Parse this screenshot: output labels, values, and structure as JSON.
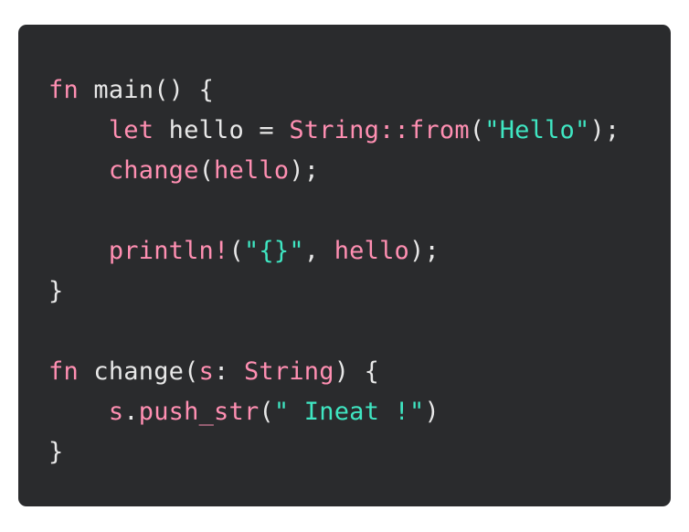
{
  "colors": {
    "background": "#2a2b2d",
    "plain": "#e8e8e8",
    "keyword": "#ff8fb2",
    "string": "#3fe6c2"
  },
  "code": {
    "lines": [
      [
        {
          "text": "fn",
          "kind": "kw"
        },
        {
          "text": " main() {",
          "kind": "plain"
        }
      ],
      [
        {
          "text": "    ",
          "kind": "plain"
        },
        {
          "text": "let",
          "kind": "kw"
        },
        {
          "text": " hello = ",
          "kind": "plain"
        },
        {
          "text": "String::from",
          "kind": "type"
        },
        {
          "text": "(",
          "kind": "plain"
        },
        {
          "text": "\"Hello\"",
          "kind": "str"
        },
        {
          "text": ");",
          "kind": "plain"
        }
      ],
      [
        {
          "text": "    ",
          "kind": "plain"
        },
        {
          "text": "change",
          "kind": "fn"
        },
        {
          "text": "(",
          "kind": "plain"
        },
        {
          "text": "hello",
          "kind": "fn"
        },
        {
          "text": ");",
          "kind": "plain"
        }
      ],
      [
        {
          "text": "",
          "kind": "plain"
        }
      ],
      [
        {
          "text": "    ",
          "kind": "plain"
        },
        {
          "text": "println!",
          "kind": "fn"
        },
        {
          "text": "(",
          "kind": "plain"
        },
        {
          "text": "\"{}\"",
          "kind": "str"
        },
        {
          "text": ", ",
          "kind": "plain"
        },
        {
          "text": "hello",
          "kind": "fn"
        },
        {
          "text": ");",
          "kind": "plain"
        }
      ],
      [
        {
          "text": "}",
          "kind": "plain"
        }
      ],
      [
        {
          "text": "",
          "kind": "plain"
        }
      ],
      [
        {
          "text": "fn",
          "kind": "kw"
        },
        {
          "text": " change(",
          "kind": "plain"
        },
        {
          "text": "s",
          "kind": "fn"
        },
        {
          "text": ": ",
          "kind": "plain"
        },
        {
          "text": "String",
          "kind": "type"
        },
        {
          "text": ") {",
          "kind": "plain"
        }
      ],
      [
        {
          "text": "    ",
          "kind": "plain"
        },
        {
          "text": "s",
          "kind": "fn"
        },
        {
          "text": ".",
          "kind": "plain"
        },
        {
          "text": "push_str",
          "kind": "fn"
        },
        {
          "text": "(",
          "kind": "plain"
        },
        {
          "text": "\" Ineat !\"",
          "kind": "str"
        },
        {
          "text": ")",
          "kind": "plain"
        }
      ],
      [
        {
          "text": "}",
          "kind": "plain"
        }
      ]
    ]
  }
}
